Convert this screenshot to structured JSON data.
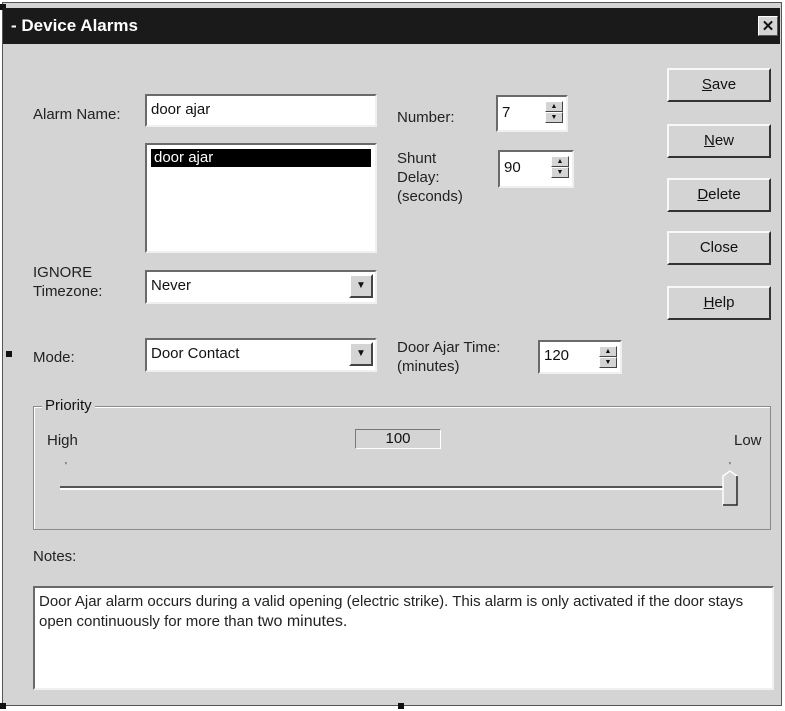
{
  "window": {
    "title": "- Device Alarms",
    "close_glyph": "✕"
  },
  "form": {
    "alarm_name_label": "Alarm Name:",
    "alarm_name_value": "door ajar",
    "alarm_list": [
      "door ajar"
    ],
    "number_label": "Number:",
    "number_value": "7",
    "shunt_delay_label": [
      "Shunt",
      "Delay:",
      "(seconds)"
    ],
    "shunt_delay_value": "90",
    "ignore_tz_label": [
      "IGNORE",
      "Timezone:"
    ],
    "ignore_tz_value": "Never",
    "mode_label": "Mode:",
    "mode_value": "Door Contact",
    "door_ajar_label": [
      "Door Ajar Time:",
      "(minutes)"
    ],
    "door_ajar_value": "120"
  },
  "buttons": [
    {
      "key": "S",
      "rest": "ave"
    },
    {
      "key": "N",
      "rest": "ew"
    },
    {
      "key": "D",
      "rest": "elete"
    },
    {
      "key": "",
      "rest": "Close"
    },
    {
      "key": "H",
      "rest": "elp"
    }
  ],
  "priority": {
    "group_label": "Priority",
    "high_label": "High",
    "low_label": "Low",
    "value_display": "100",
    "level_fraction": 1.0
  },
  "notes": {
    "label": "Notes:",
    "text": "Door Ajar alarm occurs during a valid opening (electric strike).  This alarm is only activated if the door stays open continuously for more than ",
    "text_emphasis": "two minutes."
  }
}
